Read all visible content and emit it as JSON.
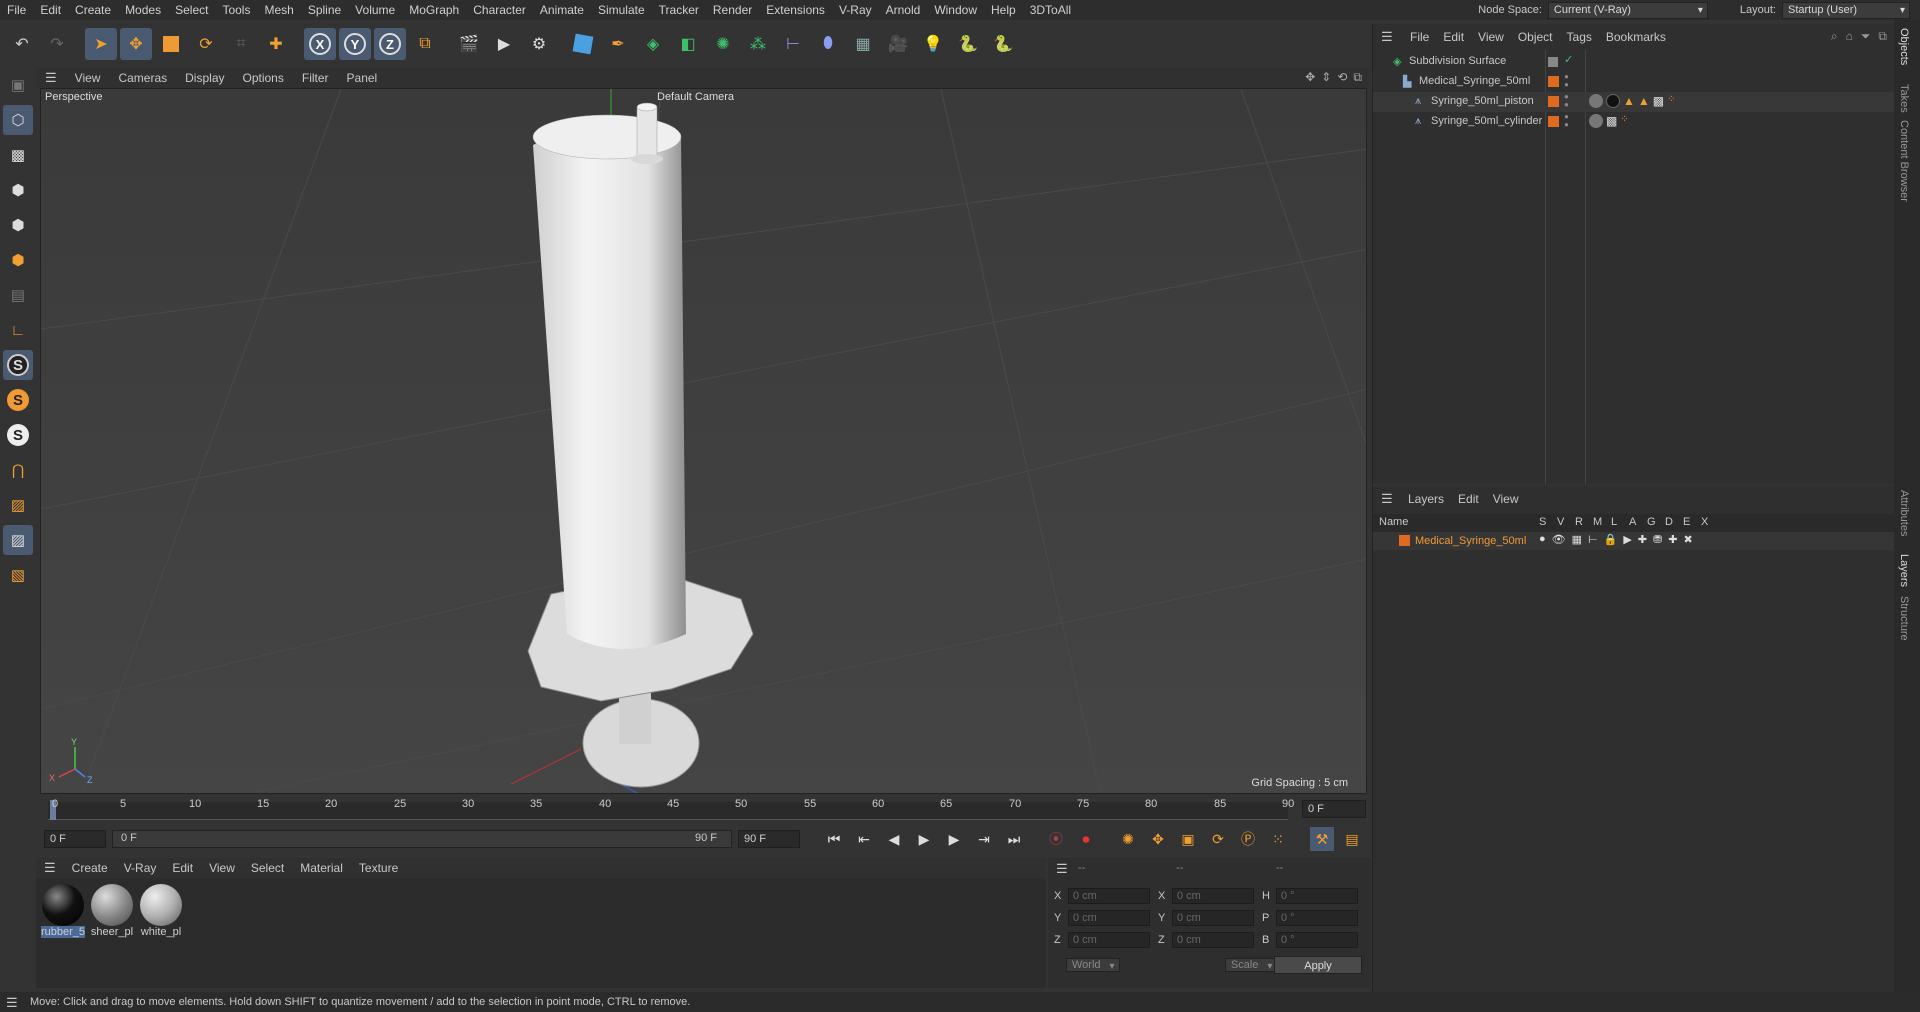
{
  "menubar": {
    "items": [
      "File",
      "Edit",
      "Create",
      "Modes",
      "Select",
      "Tools",
      "Mesh",
      "Spline",
      "Volume",
      "MoGraph",
      "Character",
      "Animate",
      "Simulate",
      "Tracker",
      "Render",
      "Extensions",
      "V-Ray",
      "Arnold",
      "Window",
      "Help",
      "3DToAll"
    ],
    "node_space_label": "Node Space:",
    "node_space_value": "Current (V-Ray)",
    "layout_label": "Layout:",
    "layout_value": "Startup (User)"
  },
  "viewport": {
    "menu": [
      "View",
      "Cameras",
      "Display",
      "Options",
      "Filter",
      "Panel"
    ],
    "view_name": "Perspective",
    "camera": "Default Camera",
    "grid_spacing": "Grid Spacing : 5 cm",
    "axis_x": "X",
    "axis_y": "Y",
    "axis_z": "Z"
  },
  "timeline": {
    "ticks": [
      "0",
      "5",
      "10",
      "15",
      "20",
      "25",
      "30",
      "35",
      "40",
      "45",
      "50",
      "55",
      "60",
      "65",
      "70",
      "75",
      "80",
      "85",
      "90"
    ],
    "current_frame_right": "0 F",
    "start_field": "0 F",
    "range_start": "0 F",
    "range_end": "90 F",
    "end_field": "90 F"
  },
  "materials": {
    "menu": [
      "Create",
      "V-Ray",
      "Edit",
      "View",
      "Select",
      "Material",
      "Texture"
    ],
    "items": [
      {
        "name": "rubber_5",
        "color": "#111111"
      },
      {
        "name": "sheer_pl",
        "color": "#8a8a8a"
      },
      {
        "name": "white_pl",
        "color": "#b0b0b0"
      }
    ]
  },
  "coords": {
    "header": [
      "--",
      "--",
      "--"
    ],
    "rows": [
      {
        "a": "X",
        "av": "0 cm",
        "b": "X",
        "bv": "0 cm",
        "c": "H",
        "cv": "0 °"
      },
      {
        "a": "Y",
        "av": "0 cm",
        "b": "Y",
        "bv": "0 cm",
        "c": "P",
        "cv": "0 °"
      },
      {
        "a": "Z",
        "av": "0 cm",
        "b": "Z",
        "bv": "0 cm",
        "c": "B",
        "cv": "0 °"
      }
    ],
    "mode1": "World",
    "mode2": "Scale",
    "apply": "Apply"
  },
  "objects": {
    "menu": [
      "File",
      "Edit",
      "View",
      "Object",
      "Tags",
      "Bookmarks"
    ],
    "items": [
      {
        "name": "Subdivision Surface"
      },
      {
        "name": "Medical_Syringe_50ml"
      },
      {
        "name": "Syringe_50ml_piston"
      },
      {
        "name": "Syringe_50ml_cylinder"
      }
    ]
  },
  "layers": {
    "menu": [
      "Layers",
      "Edit",
      "View"
    ],
    "name_header": "Name",
    "cols": [
      "S",
      "V",
      "R",
      "M",
      "L",
      "A",
      "G",
      "D",
      "E",
      "X"
    ],
    "items": [
      {
        "name": "Medical_Syringe_50ml"
      }
    ]
  },
  "side_tabs": [
    "Objects",
    "Takes",
    "Content Browser",
    "Attributes",
    "Layers",
    "Structure"
  ],
  "status": "Move: Click and drag to move elements. Hold down SHIFT to quantize movement / add to the selection in point mode, CTRL to remove."
}
